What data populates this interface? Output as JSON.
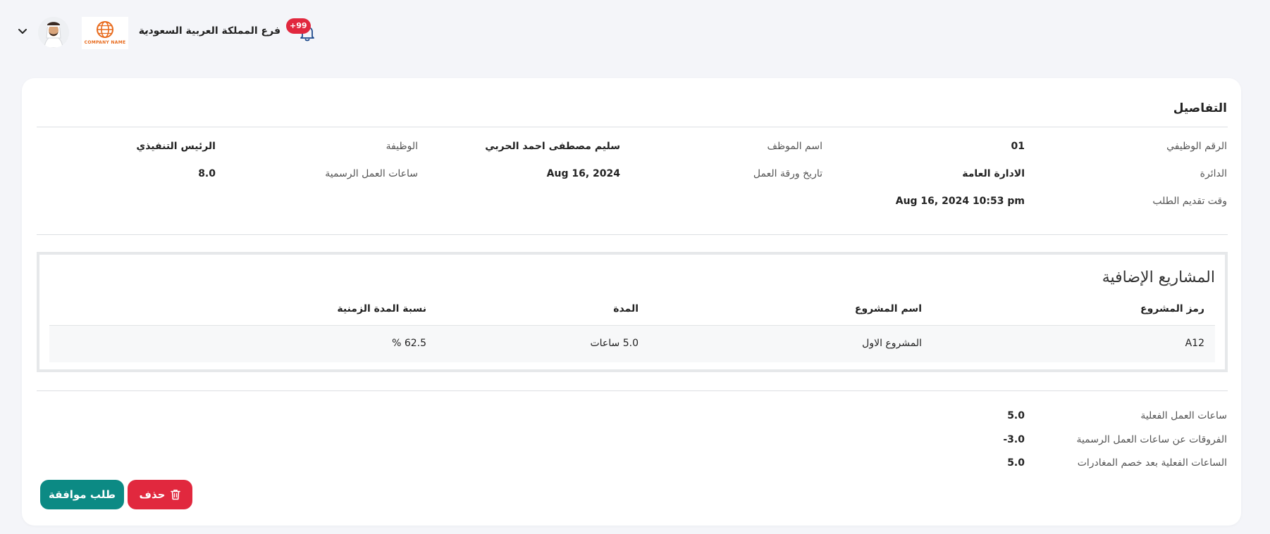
{
  "header": {
    "branch_name": "فرع المملكة العربية السعودية",
    "notifications_badge": "+99",
    "company_logo_text": "COMPANY NAME"
  },
  "details": {
    "title": "التفاصيل",
    "employee_no_label": "الرقم الوظيفي",
    "employee_no_value": "01",
    "employee_name_label": "اسم الموظف",
    "employee_name_value": "سليم مصطفى احمد الحربي",
    "job_label": "الوظيفة",
    "job_value": "الرئيس التنفيذي",
    "department_label": "الدائرة",
    "department_value": "الادارة العامة",
    "timesheet_date_label": "تاريخ ورقة العمل",
    "timesheet_date_value": "Aug 16, 2024",
    "official_hours_label": "ساعات العمل الرسمية",
    "official_hours_value": "8.0",
    "submission_time_label": "وقت تقديم الطلب",
    "submission_time_value": "Aug 16, 2024 10:53 pm"
  },
  "projects": {
    "title": "المشاريع الإضافية",
    "columns": [
      "رمز المشروع",
      "اسم المشروع",
      "المدة",
      "نسبة المدة الزمنية"
    ],
    "rows": [
      {
        "code": "A12",
        "name": "المشروع الاول",
        "duration": "5.0 ساعات",
        "ratio": "62.5 %"
      }
    ]
  },
  "summary": {
    "actual_hours_label": "ساعات العمل الفعلية",
    "actual_hours_value": "5.0",
    "difference_label": "الفروقات عن ساعات العمل الرسمية",
    "difference_value": "-3.0",
    "net_hours_label": "الساعات الفعلية بعد خصم المغادرات",
    "net_hours_value": "5.0"
  },
  "actions": {
    "approve_label": "طلب موافقة",
    "delete_label": "حذف"
  },
  "colors": {
    "approve": "#0c8a84",
    "delete": "#e1283e",
    "badge": "#e1283e"
  }
}
